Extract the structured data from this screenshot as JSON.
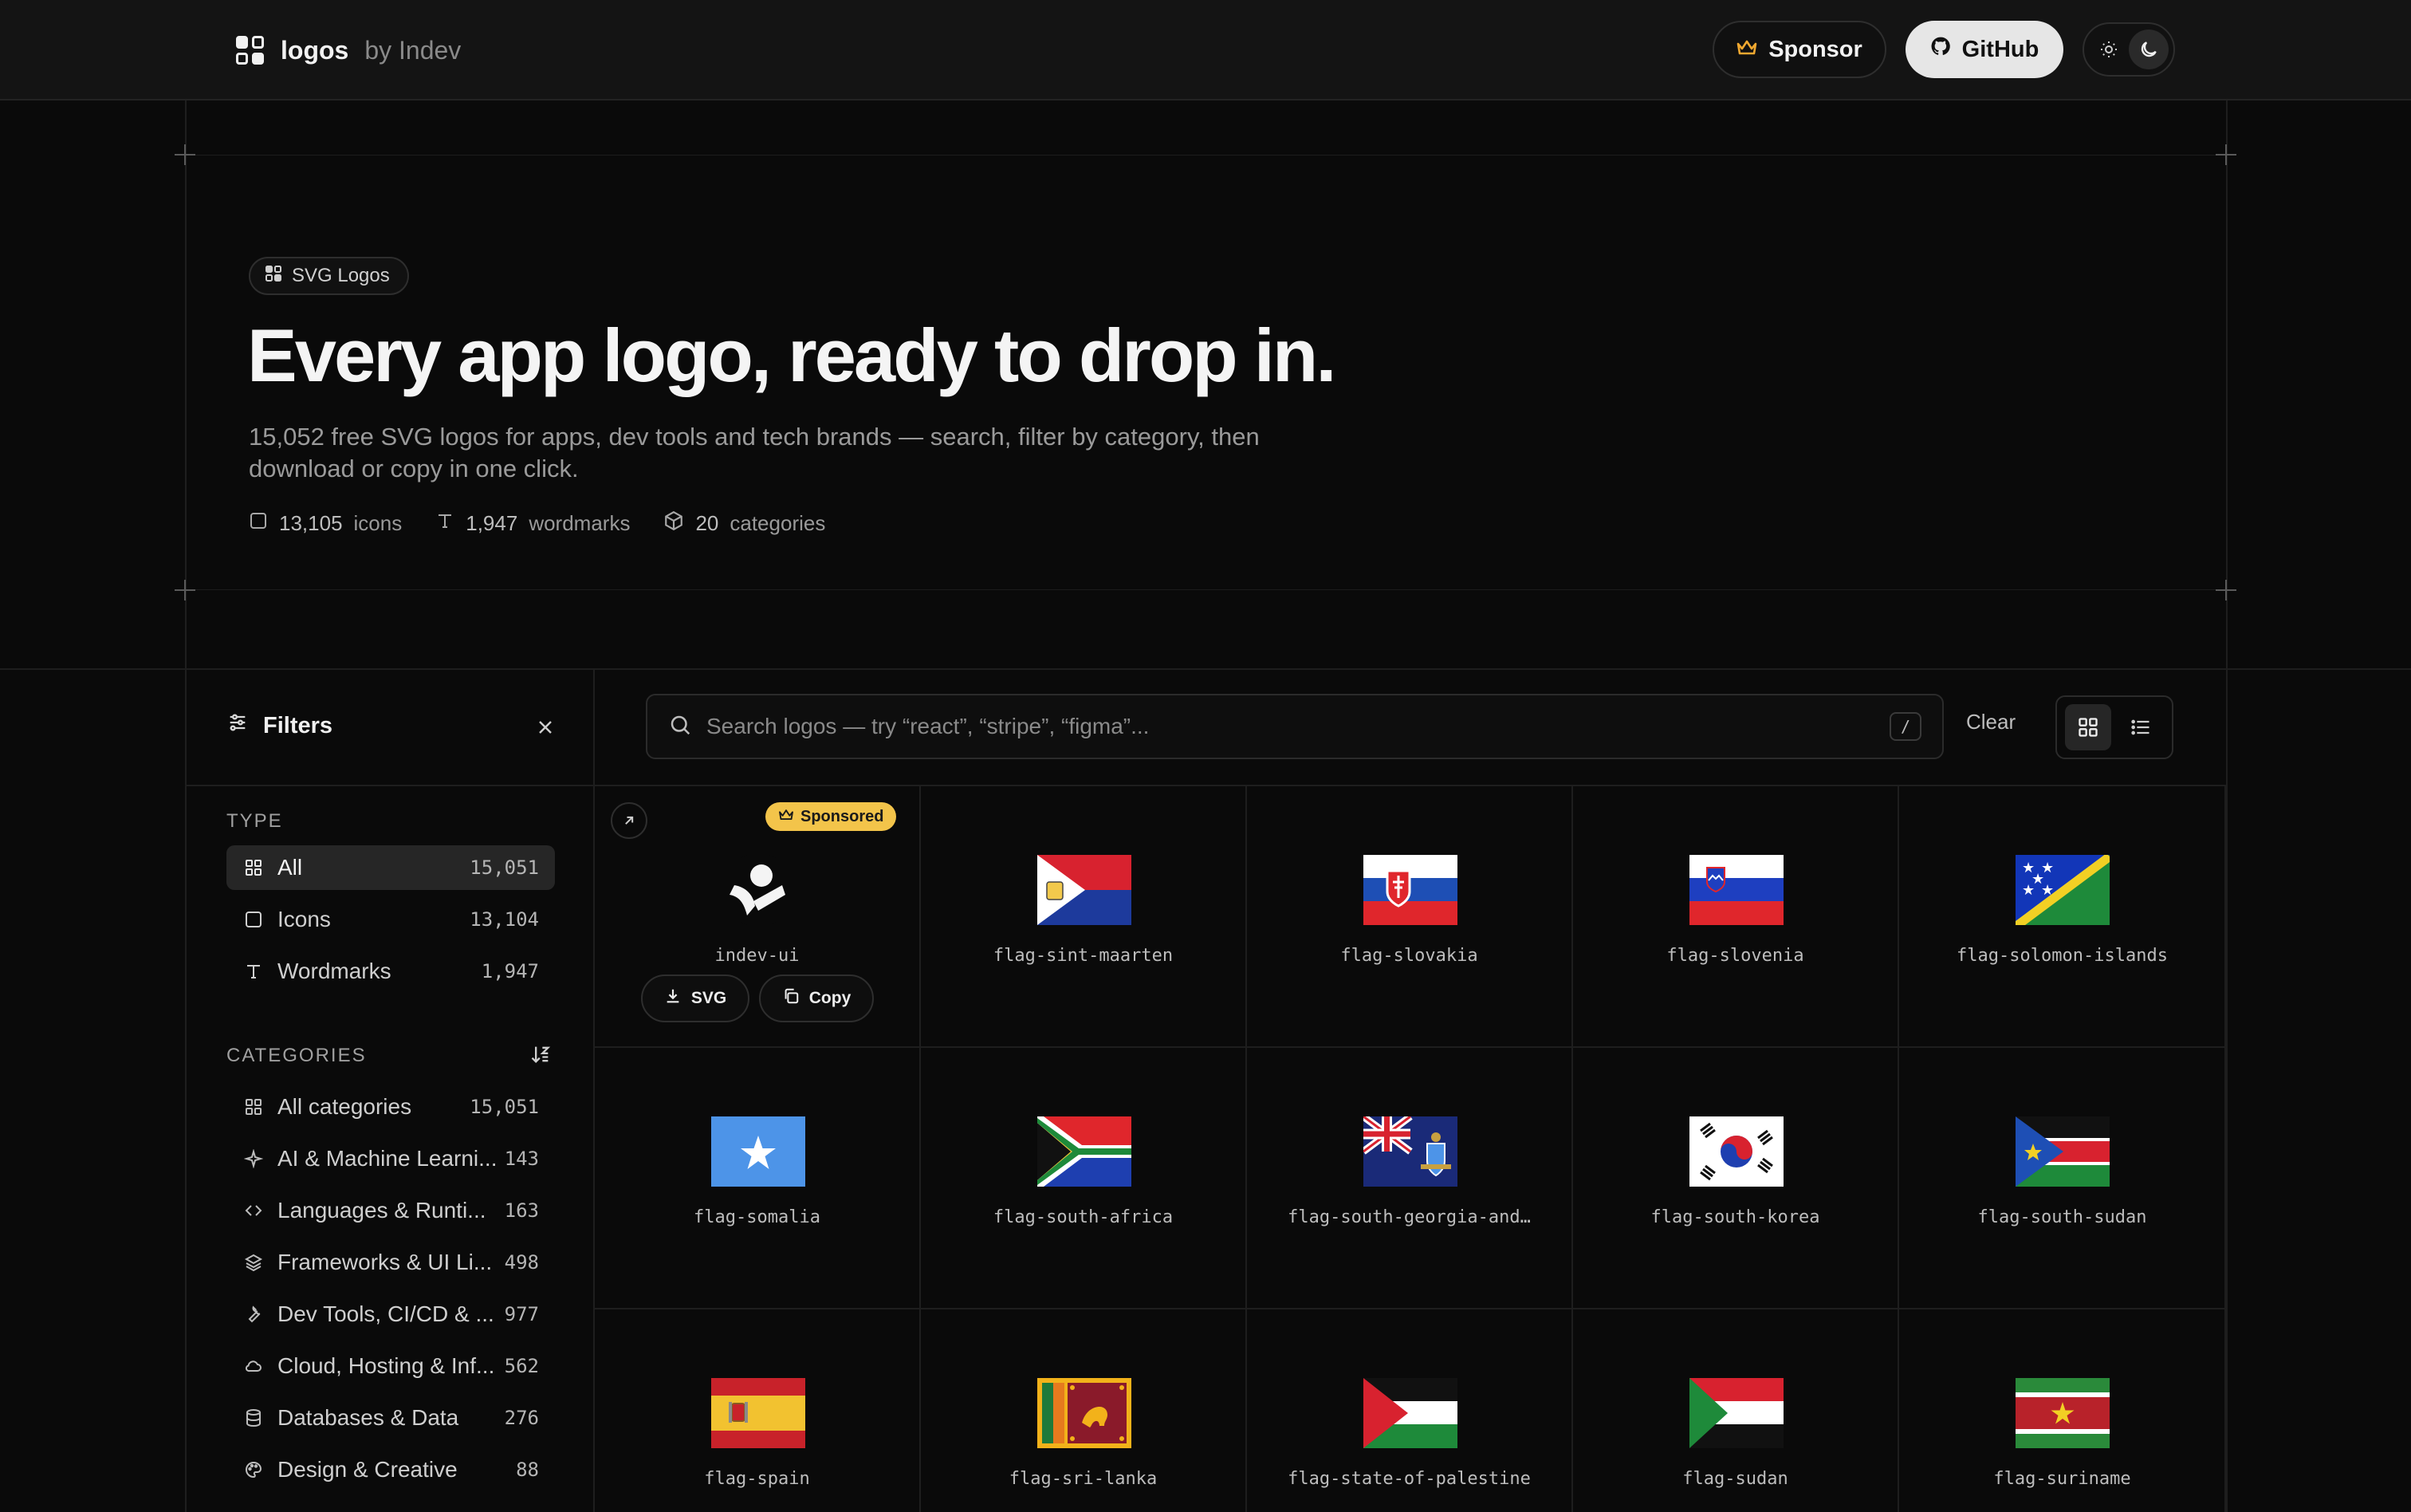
{
  "nav": {
    "brand_name": "logos",
    "brand_by": "by Indev",
    "sponsor_label": "Sponsor",
    "github_label": "GitHub",
    "theme_options": [
      "light",
      "dark"
    ],
    "theme_selected": "dark"
  },
  "hero": {
    "badge": "SVG Logos",
    "title": "Every app logo, ready to drop in.",
    "subtitle": "15,052 free SVG logos for apps, dev tools and tech brands — search, filter by category, then download or copy in one click.",
    "stats": [
      {
        "value": "13,105",
        "label": "icons",
        "icon": "square-icon"
      },
      {
        "value": "1,947",
        "label": "wordmarks",
        "icon": "type-icon"
      },
      {
        "value": "20",
        "label": "categories",
        "icon": "box-icon"
      }
    ]
  },
  "filters": {
    "title": "Filters",
    "type_label": "TYPE",
    "types": [
      {
        "label": "All",
        "count": "15,051",
        "icon": "grid-icon",
        "active": true
      },
      {
        "label": "Icons",
        "count": "13,104",
        "icon": "square-icon",
        "active": false
      },
      {
        "label": "Wordmarks",
        "count": "1,947",
        "icon": "type-icon",
        "active": false
      }
    ],
    "categories_label": "CATEGORIES",
    "categories": [
      {
        "label": "All categories",
        "count": "15,051",
        "icon": "grid-icon"
      },
      {
        "label": "AI & Machine Learni...",
        "count": "143",
        "icon": "sparkle-icon"
      },
      {
        "label": "Languages & Runti...",
        "count": "163",
        "icon": "code-icon"
      },
      {
        "label": "Frameworks & UI Li...",
        "count": "498",
        "icon": "layers-icon"
      },
      {
        "label": "Dev Tools, CI/CD & ...",
        "count": "977",
        "icon": "wrench-icon"
      },
      {
        "label": "Cloud, Hosting & Inf...",
        "count": "562",
        "icon": "cloud-icon"
      },
      {
        "label": "Databases & Data",
        "count": "276",
        "icon": "database-icon"
      },
      {
        "label": "Design & Creative",
        "count": "88",
        "icon": "palette-icon"
      }
    ]
  },
  "toolbar": {
    "search_placeholder": "Search logos — try “react”, “stripe”, “figma”...",
    "search_shortcut": "/",
    "clear_label": "Clear",
    "view_selected": "grid"
  },
  "grid": {
    "sponsored_label": "Sponsored",
    "svg_button": "SVG",
    "copy_button": "Copy",
    "items": [
      {
        "name": "indev-ui",
        "sponsored": true
      },
      {
        "name": "flag-sint-maarten"
      },
      {
        "name": "flag-slovakia"
      },
      {
        "name": "flag-slovenia"
      },
      {
        "name": "flag-solomon-islands"
      },
      {
        "name": "flag-somalia"
      },
      {
        "name": "flag-south-africa"
      },
      {
        "name": "flag-south-georgia-and…"
      },
      {
        "name": "flag-south-korea"
      },
      {
        "name": "flag-south-sudan"
      },
      {
        "name": "flag-spain"
      },
      {
        "name": "flag-sri-lanka"
      },
      {
        "name": "flag-state-of-palestine"
      },
      {
        "name": "flag-sudan"
      },
      {
        "name": "flag-suriname"
      }
    ]
  },
  "colors": {
    "background": "#0a0a0a",
    "accent_sponsored": "#f3c44a",
    "sponsor_crown": "#f0a830"
  }
}
